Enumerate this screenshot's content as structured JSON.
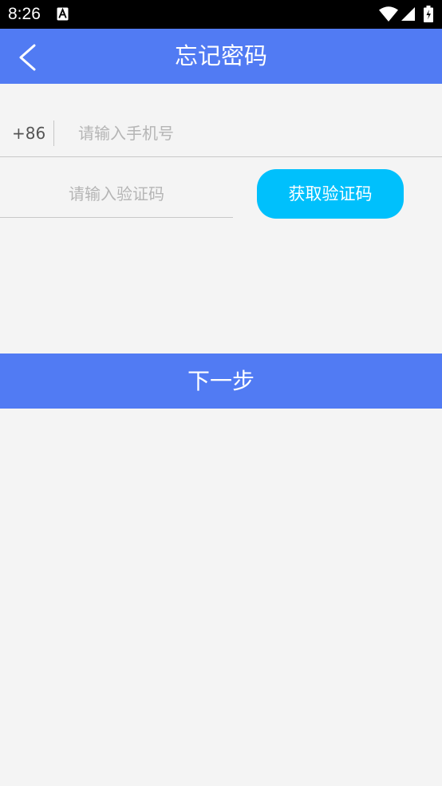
{
  "status_bar": {
    "time": "8:26",
    "icons": [
      "a-notification-icon",
      "wifi-icon",
      "signal-icon",
      "battery-icon"
    ]
  },
  "app_bar": {
    "title": "忘记密码",
    "back_icon": "chevron-left-icon",
    "color": "#517bf3"
  },
  "form": {
    "country_code": "+86",
    "phone_placeholder": "请输入手机号",
    "phone_value": "",
    "code_placeholder": "请输入验证码",
    "code_value": "",
    "get_code_label": "获取验证码",
    "get_code_color": "#00c0fc"
  },
  "next_button": {
    "label": "下一步",
    "color": "#517bf3"
  }
}
